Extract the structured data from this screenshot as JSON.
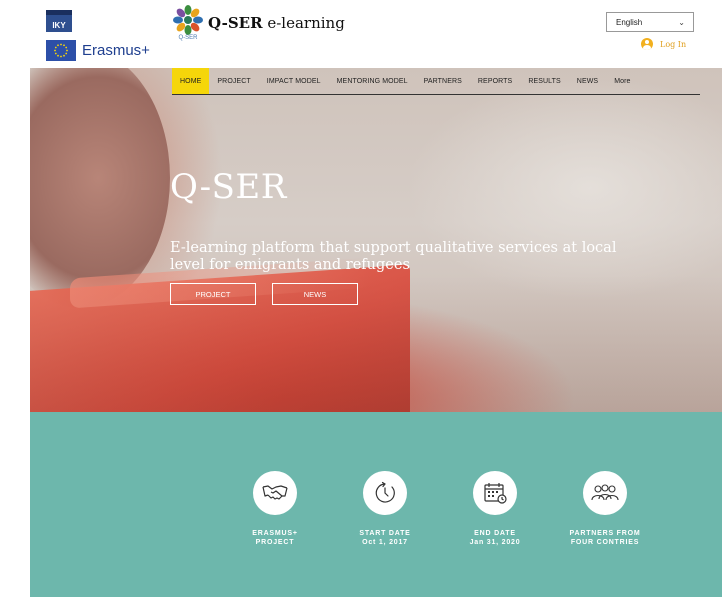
{
  "partner_logos": {
    "iky": "IKY",
    "erasmus": "Erasmus+"
  },
  "brand": {
    "logo_caption": "Q-SER",
    "title_bold": "Q-SER",
    "title_rest": " e-learning"
  },
  "language": {
    "selected": "English"
  },
  "login": {
    "label": "Log In"
  },
  "nav": {
    "items": [
      {
        "label": "HOME",
        "active": true
      },
      {
        "label": "PROJECT"
      },
      {
        "label": "IMPACT MODEL"
      },
      {
        "label": "MENTORING MODEL"
      },
      {
        "label": "PARTNERS"
      },
      {
        "label": "REPORTS"
      },
      {
        "label": "RESULTS"
      },
      {
        "label": "NEWS"
      },
      {
        "label": "More"
      }
    ]
  },
  "hero": {
    "title": "Q-SER",
    "subtitle": "E-learning platform that support qualitative services at local level for emigrants and refugees",
    "buttons": {
      "project": "PROJECT",
      "news": "NEWS"
    }
  },
  "stats": [
    {
      "icon": "handshake-icon",
      "line1": "ERASMUS+",
      "line2": "PROJECT"
    },
    {
      "icon": "clock-icon",
      "line1": "START DATE",
      "line2": "Oct 1, 2017"
    },
    {
      "icon": "calendar-icon",
      "line1": "END DATE",
      "line2": "Jan 31, 2020"
    },
    {
      "icon": "people-icon",
      "line1": "PARTNERS FROM",
      "line2": "FOUR CONTRIES"
    }
  ],
  "colors": {
    "nav_active": "#f5d60a",
    "teal_section": "#6db7ac",
    "login_accent": "#e0a020"
  }
}
